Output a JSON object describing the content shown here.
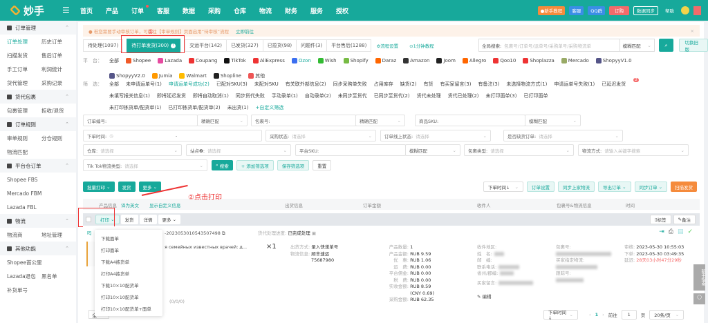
{
  "app": {
    "logo": "妙手"
  },
  "nav": {
    "items": [
      "首页",
      "产品",
      "订单",
      "客服",
      "数据",
      "采购",
      "仓库",
      "物流",
      "财务",
      "服务",
      "授权"
    ],
    "top_buttons": {
      "tutorial": "●新手教程",
      "service": "客服",
      "qq": "QQ群",
      "order": "订购",
      "sync": "数据同步",
      "help": "帮助"
    }
  },
  "colors": {
    "brand": "#17a99b",
    "annotation": "#e33333",
    "orange": "#f58b3c"
  },
  "sidebar": {
    "groups": [
      {
        "title": "订单管理",
        "icon": "order-icon",
        "items": [
          "订单处理",
          "历史订单",
          "扫描发货",
          "售后订单",
          "手工订单",
          "利润统计",
          "货代管理",
          "采购记录"
        ]
      },
      {
        "title": "货代包裹",
        "icon": "package-icon",
        "items": [
          "包裹管理",
          "拒收/退货"
        ]
      },
      {
        "title": "订单规则",
        "icon": "rule-icon",
        "items": [
          "审单规则",
          "分仓规则",
          "物流匹配"
        ]
      },
      {
        "title": "平台仓订单",
        "icon": "warehouse-icon",
        "items": [
          "Shopee FBS",
          "Mercado FBM",
          "Lazada FBL"
        ]
      },
      {
        "title": "物流",
        "icon": "location-icon",
        "items": [
          "物流商",
          "地址管理"
        ]
      },
      {
        "title": "其他功能",
        "icon": "grid-icon",
        "items": [
          "Shopee首公里",
          "Lazada退包",
          "黑名单",
          "补货单号"
        ]
      }
    ]
  },
  "notice": {
    "text": "● 若您需要手动审核订单，可前往【审单规则】页面启用“待审核”流程",
    "link": "立即前往"
  },
  "tabs": [
    "待处理(1097)",
    "待打单发货(300)",
    "交运平台(142)",
    "已发货(327)",
    "已揽货(98)",
    "问题件(3)",
    "平台售后(1288)"
  ],
  "tab_links": [
    "⚙流程设置",
    "⊙1分钟教程"
  ],
  "annotations": {
    "step1": "①",
    "step2": "②点击打印"
  },
  "global_search": {
    "label": "全局搜索:",
    "placeholder": "包裹号/订单号/运单号/采购单号/采购物流单",
    "match": "模糊匹配",
    "switch": "切换旧版"
  },
  "platform_filter": {
    "label": "平　台：",
    "items": [
      "全部",
      "Shopee",
      "Lazada",
      "Coupang",
      "TikTok",
      "AliExpress",
      "Ozon",
      "Wish",
      "Shopify",
      "Daraz",
      "Amazon",
      "Joom",
      "Allegro",
      "Qoo10",
      "Shoplazza",
      "Mercado",
      "ShopyyV1.0",
      "ShopyyV2.0",
      "Jumia",
      "Walmart",
      "Shopline",
      "其他"
    ]
  },
  "screen_filter": {
    "label": "筛　选：",
    "items": [
      "全部",
      "未申请运单号(1)",
      "申请运单号成功(2)",
      "已配对SKU(3)",
      "未配对SKU",
      "有关联外部信息(2)",
      "同步采购单失败",
      "占用库存",
      "缺货(2)",
      "有货",
      "有买家留言(3)",
      "有备注(3)",
      "未选择物流方式(1)",
      "申请运单号失败(1)",
      "已延迟发货",
      "未填写报关信息(1)",
      "即将延迟发货",
      "即将自动取消(1)",
      "同步货代失败",
      "手动录单(1)",
      "自动录单(2)",
      "未同步至货代",
      "已同步至货代(2)",
      "货代未处理",
      "货代已处理(2)",
      "未打印面单(3)",
      "已打印面单",
      "未打印拣货单/配货单(1)",
      "已打印拣货单/配货单(2)",
      "未出货(1)",
      "+自定义筛选"
    ],
    "delay_badge": "2"
  },
  "search_form": {
    "order_no": "订单编号:",
    "match1": "精确匹配",
    "package_no": "包裹号:",
    "match2": "精确匹配",
    "sku": "商品SKU:",
    "match3": "模糊匹配",
    "order_time": "下单时间:",
    "dash": "-",
    "purchase_status": "采购状态:",
    "online_status": "订单线上状态:",
    "out_of_stock": "是否缺货订单:",
    "warehouse": "仓库:",
    "site": "站点❷:",
    "platform_sku": "平台SKU:",
    "match4": "模糊匹配",
    "package_type": "包裹类型:",
    "logistics": "物流方式:",
    "logistics_ph": "请输入关键字搜索",
    "tiktok_type": "Tik Tok物流类型:",
    "placeholder": "请选择",
    "search": "搜索",
    "add_filter": "+ 添加筛选项",
    "save_filter": "保存筛选项",
    "reset": "重置"
  },
  "actions": {
    "batch_print": "批量打印",
    "ship": "发货",
    "more": "更多",
    "sort": "下单时间↓",
    "order_settings": "订单设置",
    "sync_logistics": "同步上家物流",
    "export": "导出订单",
    "sync_orders": "同步订单",
    "scan_ship": "扫描发货"
  },
  "table_header": {
    "product": "产品信息",
    "translate": "译为英文",
    "custom": "显示自定义信息",
    "shipping": "出货信息",
    "amount": "订单金额",
    "receiver": "收件人",
    "package": "包裹号&物流信息",
    "time": "时间"
  },
  "order_toolbar": {
    "print": "打印",
    "ship": "发货",
    "detail": "详情",
    "more": "更多",
    "tag": "标签",
    "remark": "备注"
  },
  "print_menu": [
    "下载面单",
    "打印面单",
    "下载A4拣货单",
    "打印A4拣货单",
    "下载10×10配货单",
    "打印10×10配货单",
    "打印10×10配货单+面单"
  ],
  "order": {
    "order_no": "-20230530105435074​98",
    "forwarder_status_label": "货代处理进度:",
    "forwarder_status": "已完成处理",
    "product_title": "я семейных известных врачей: д...",
    "qty": "×1",
    "dim": "(0/0/0)",
    "ship_method_label": "出货方式:",
    "ship_method": "录入快递单号",
    "logistics_label": "物流信息:",
    "carrier": "顺丰速运",
    "tracking": "75687980",
    "amounts": [
      [
        "产品数量:",
        "1"
      ],
      [
        "产品金额:",
        "RUB 9.59"
      ],
      [
        "优　惠:",
        "RUB 1.06"
      ],
      [
        "运　费:",
        "RUB 0.00"
      ],
      [
        "平台佣金:",
        "RUB 0.00"
      ],
      [
        "税　费:",
        "RUB 0.00"
      ],
      [
        "实收金额:",
        "RUB 8.59"
      ],
      [
        "",
        "(CNY 0.69)"
      ],
      [
        "采购金额:",
        "RUB 62.35"
      ]
    ],
    "receiver_labels": [
      "收件地区:",
      "姓　名:",
      "邮　编:",
      "联系电话:",
      "省州/郡编:",
      "买家留言:"
    ],
    "edit": "编辑",
    "package_labels": [
      "包裹号:",
      "买家指定物流:",
      "跟踪号:"
    ],
    "times": [
      [
        "审核:",
        "2023-05-30 10:55:03"
      ],
      [
        "下单:",
        "2023-05-30 03:49:35"
      ],
      [
        "延迟:",
        "28天03小时47分29秒"
      ]
    ]
  },
  "pagination": {
    "sort": "下单时间↓",
    "page": "1",
    "goto": "前往",
    "goto_value": "1",
    "page_unit": "页",
    "size": "20条/页",
    "select_all": "全"
  },
  "float": {
    "guide": "新手指南"
  }
}
